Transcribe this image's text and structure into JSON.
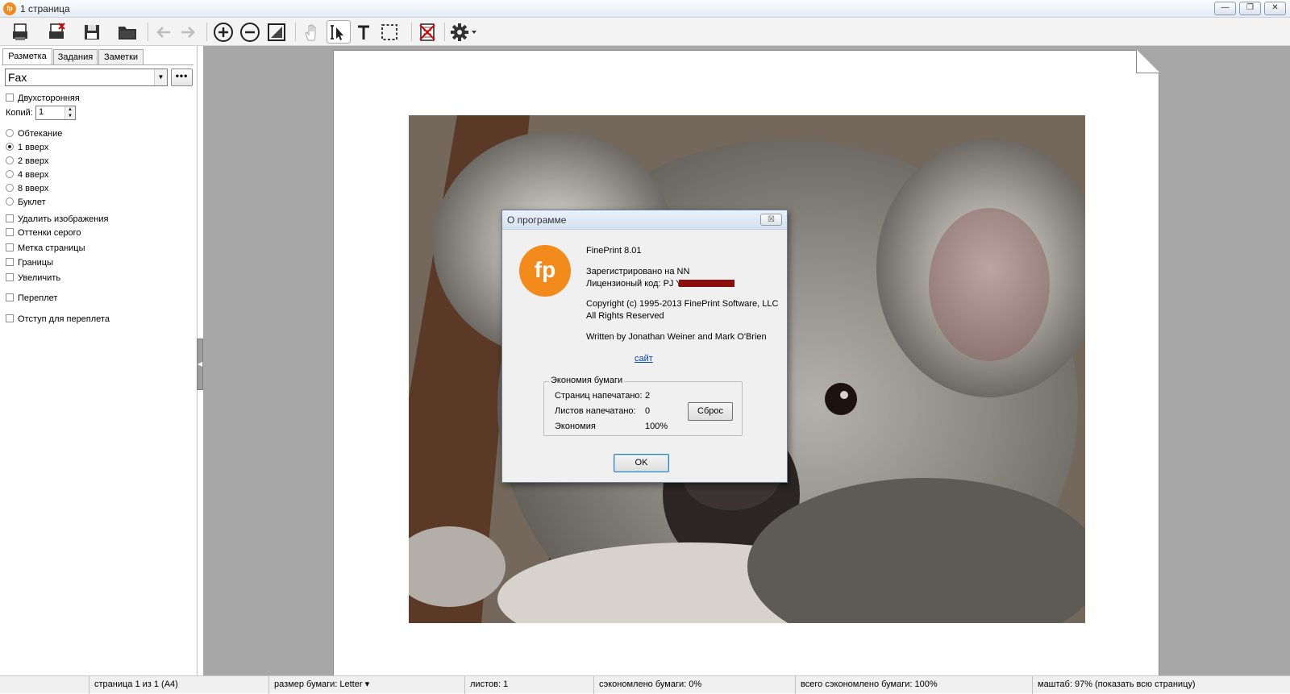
{
  "window": {
    "title": "1 страница",
    "app_icon": "fp",
    "buttons": [
      "—",
      "❐",
      "✕"
    ]
  },
  "toolbar": {
    "icons": [
      "print-icon",
      "print-delete-icon",
      "save-icon",
      "open-folder-icon",
      "back-arrow-icon",
      "forward-arrow-icon",
      "zoom-in-icon",
      "zoom-out-icon",
      "fit-page-icon",
      "hand-icon",
      "text-select-icon",
      "text-tool-icon",
      "marquee-select-icon",
      "delete-job-icon",
      "settings-icon"
    ]
  },
  "sidebar": {
    "tabs": [
      "Разметка",
      "Задания",
      "Заметки"
    ],
    "profile_value": "Fax",
    "more_label": "•••",
    "duplex_label": "Двухсторонняя",
    "copies_label": "Копий:",
    "copies_value": "1",
    "layouts": [
      {
        "label": "Обтекание",
        "selected": false
      },
      {
        "label": "1 вверх",
        "selected": true
      },
      {
        "label": "2 вверх",
        "selected": false
      },
      {
        "label": "4 вверх",
        "selected": false
      },
      {
        "label": "8 вверх",
        "selected": false
      },
      {
        "label": "Буклет",
        "selected": false
      }
    ],
    "options": [
      "Удалить изображения",
      "Оттенки серого",
      "Метка страницы",
      "Границы",
      "Увеличить",
      "Переплет",
      "Отступ для переплета"
    ]
  },
  "dialog": {
    "title": "О программе",
    "close": "☒",
    "logo_text": "fp",
    "product": "FinePrint 8.01",
    "registered": "Зарегистрировано на NN",
    "license": "Лицензионый код: PJ              Y",
    "copyright": "Copyright (c) 1995-2013 FinePrint Software, LLC",
    "rights": "All Rights Reserved",
    "authors": "Written by Jonathan Weiner and Mark O'Brien",
    "site_link": "сайт",
    "group_title": "Экономия бумаги",
    "pages_label": "Страниц напечатано:",
    "pages_value": "2",
    "sheets_label": "Листов напечатано:",
    "sheets_value": "0",
    "economy_label": "Экономия",
    "economy_value": "100%",
    "reset_label": "Сброс",
    "ok_label": "OK"
  },
  "statusbar": {
    "page": "страница 1 из 1 (A4)",
    "paper": "размер бумаги: Letter ▾",
    "sheets": "листов: 1",
    "saved": "сэкономлено бумаги: 0%",
    "total_saved": "всего сэкономлено бумаги: 100%",
    "zoom": "маштаб: 97% (показать всю страницу)"
  }
}
